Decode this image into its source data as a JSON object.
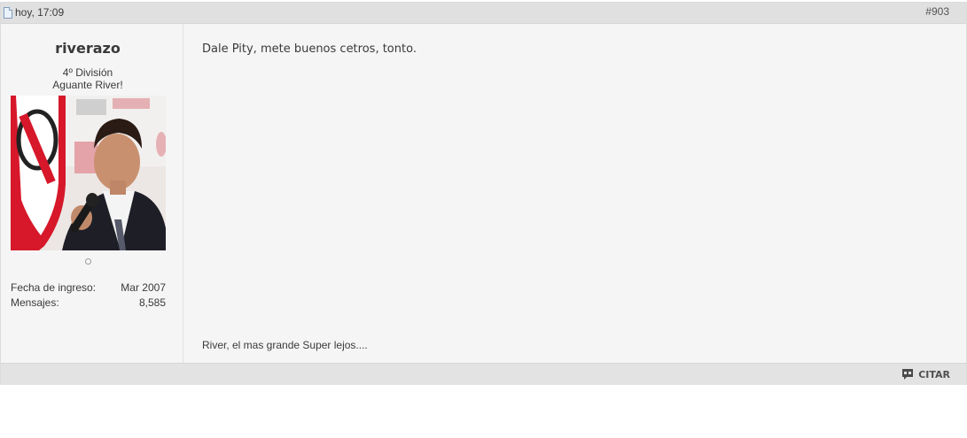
{
  "post": {
    "date": "hoy, 17:09",
    "number": "#903",
    "user": {
      "name": "riverazo",
      "rank": "4º División",
      "custom_title": "Aguante River!",
      "stats": [
        {
          "label": "Fecha de ingreso:",
          "value": "Mar 2007"
        },
        {
          "label": "Mensajes:",
          "value": "8,585"
        }
      ]
    },
    "message": "Dale Pity, mete buenos cetros, tonto.",
    "signature": "River, el mas grande Super lejos....",
    "actions": {
      "quote_label": "CITAR"
    }
  },
  "colors": {
    "header_bg": "#e0e0e0",
    "post_bg": "#f5f5f5",
    "river_red": "#d6182a"
  }
}
